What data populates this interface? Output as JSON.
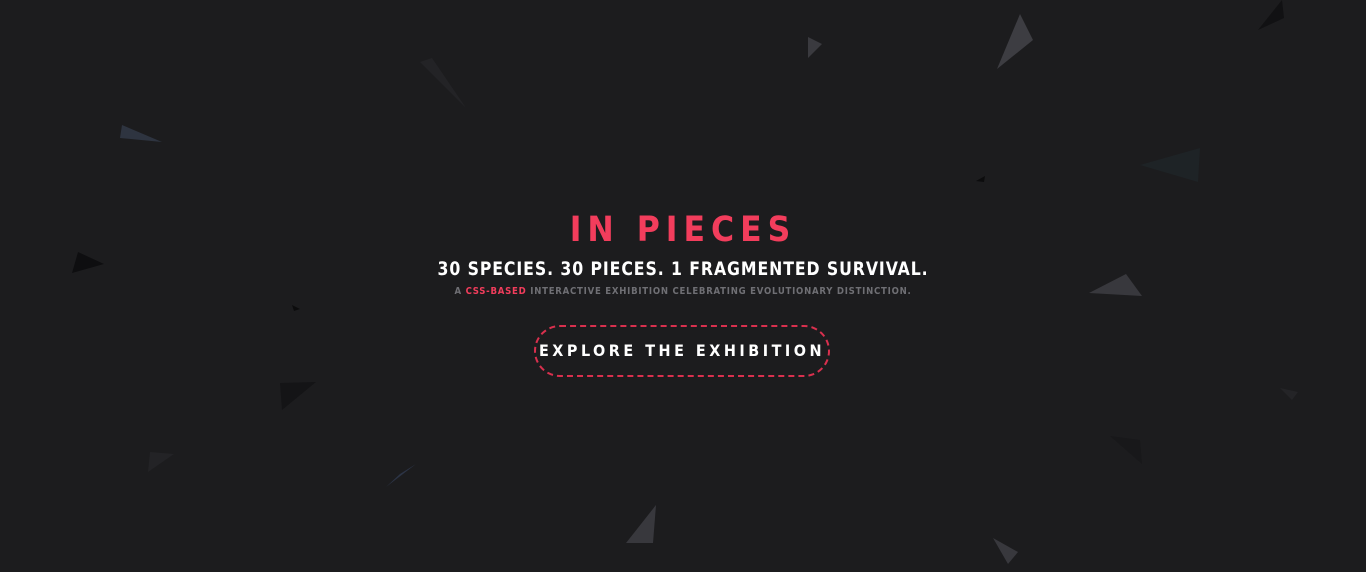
{
  "hero": {
    "title": "IN PIECES",
    "subtitle": "30 SPECIES. 30 PIECES. 1 FRAGMENTED SURVIVAL.",
    "tagline_prefix": "A",
    "tagline_accent": "CSS-BASED",
    "tagline_suffix": "INTERACTIVE EXHIBITION CELEBRATING EVOLUTIONARY DISTINCTION.",
    "cta_label": "EXPLORE THE EXHIBITION"
  },
  "colors": {
    "background": "#1c1c1e",
    "accent": "#f23d5c",
    "text": "#ffffff",
    "muted": "#6f6f74"
  }
}
